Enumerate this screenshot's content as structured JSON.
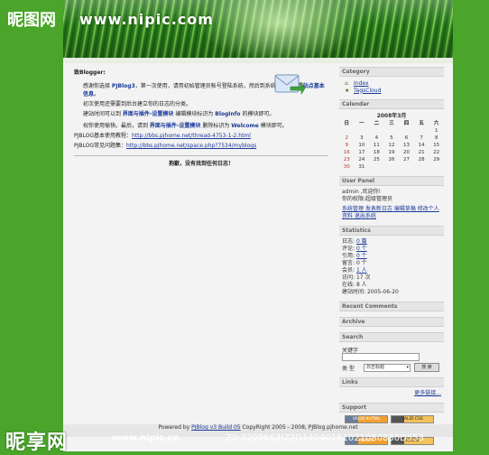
{
  "watermark": {
    "top_brand": "昵图网",
    "bottom_brand": "昵享网",
    "bottom_url": "www.nipic.cn",
    "bottom_id": "Z0:3299663IZ2D14040161021080830D553"
  },
  "banner": {
    "site_text": "www.nipic.com"
  },
  "main": {
    "greeting": "致Blogger:",
    "para1_prefix": "感谢你选择 ",
    "para1_em1": "PJBlog3",
    "para1_text": "，第一次使用，请用初始管理员帐号登陆系统，然后到系统管理，设置",
    "para1_em2": "站点基本信息",
    "para1_end": "。",
    "para2": "初次使用还需要到后台建立你的日志的分类。",
    "para3_prefix": "建站时间可以到 ",
    "para3_em1": "界面与插件-设置模块",
    "para3_mid": " 编辑模块标识为 ",
    "para3_em2": "BlogInfo",
    "para3_end": " 的模块即可。",
    "para4_prefix": "祝你使用愉快。最后，请到 ",
    "para4_em1": "界面与插件-设置模块",
    "para4_mid": " 删除标识为 ",
    "para4_em2": "Welcome",
    "para4_end": " 模块即可。",
    "help_label": "PJBLOG基本使用教程：",
    "help_link": "http://bbs.pjhome.net/thread-4753-1-2.html",
    "faq_label": "PJBLOG常见问题集：",
    "faq_link": "http://bbs.pjhome.net/space.php?7534/myblogs",
    "closing": "抱歉，没有找到任何日志！"
  },
  "sidebar": {
    "category_title": "Category",
    "categories": [
      "Index",
      "TagsCloud"
    ],
    "calendar_title": "Calendar",
    "calendar_month": "2008年3月",
    "calendar_dow": [
      "日",
      "一",
      "二",
      "三",
      "四",
      "五",
      "六"
    ],
    "calendar_rows": [
      [
        "",
        "",
        "",
        "",
        "",
        "",
        "1"
      ],
      [
        "2",
        "3",
        "4",
        "5",
        "6",
        "7",
        "8"
      ],
      [
        "9",
        "10",
        "11",
        "12",
        "13",
        "14",
        "15"
      ],
      [
        "16",
        "17",
        "18",
        "19",
        "20",
        "21",
        "22"
      ],
      [
        "23",
        "24",
        "25",
        "26",
        "27",
        "28",
        "29"
      ],
      [
        "30",
        "31",
        "",
        "",
        "",
        "",
        ""
      ]
    ],
    "userpanel_title": "User Panel",
    "user_line1": "admin ,欢迎你!",
    "user_line2": "你的权限:超级管理员",
    "user_links": "系统管理 发表新日志 编辑草稿 修改个人资料 退出系统",
    "stats_title": "Statistics",
    "stats": [
      {
        "label": "日志:",
        "value": "0 篇"
      },
      {
        "label": "评论:",
        "value": "0 个"
      },
      {
        "label": "引用:",
        "value": "0 个"
      },
      {
        "label": "留言:",
        "value": "0 个"
      },
      {
        "label": "会员:",
        "value": "1 人"
      },
      {
        "label": "访问:",
        "value": "17 次"
      },
      {
        "label": "在线:",
        "value": "8 人"
      },
      {
        "label": "建站时间:",
        "value": "2005-06-20"
      }
    ],
    "recent_comments_title": "Recent Comments",
    "archive_title": "Archive",
    "search_title": "Search",
    "search_keyword_label": "关键字",
    "search_type_label": "类 型",
    "search_type_value": "日志标题",
    "search_button": "搜 索",
    "links_title": "Links",
    "links_more": "更多链接...",
    "support_title": "Support",
    "badges": [
      "VALID XHTML",
      "VALID CSS",
      "RSS 2.0",
      "ATOM 0.3",
      "PJBLOG",
      "LOGIN"
    ]
  },
  "footer": {
    "prefix": "Powered by ",
    "link": "PJBlog v3 Build 05",
    "suffix": " CopyRight 2005 - 2008, PJBlog.pjhome.net"
  }
}
